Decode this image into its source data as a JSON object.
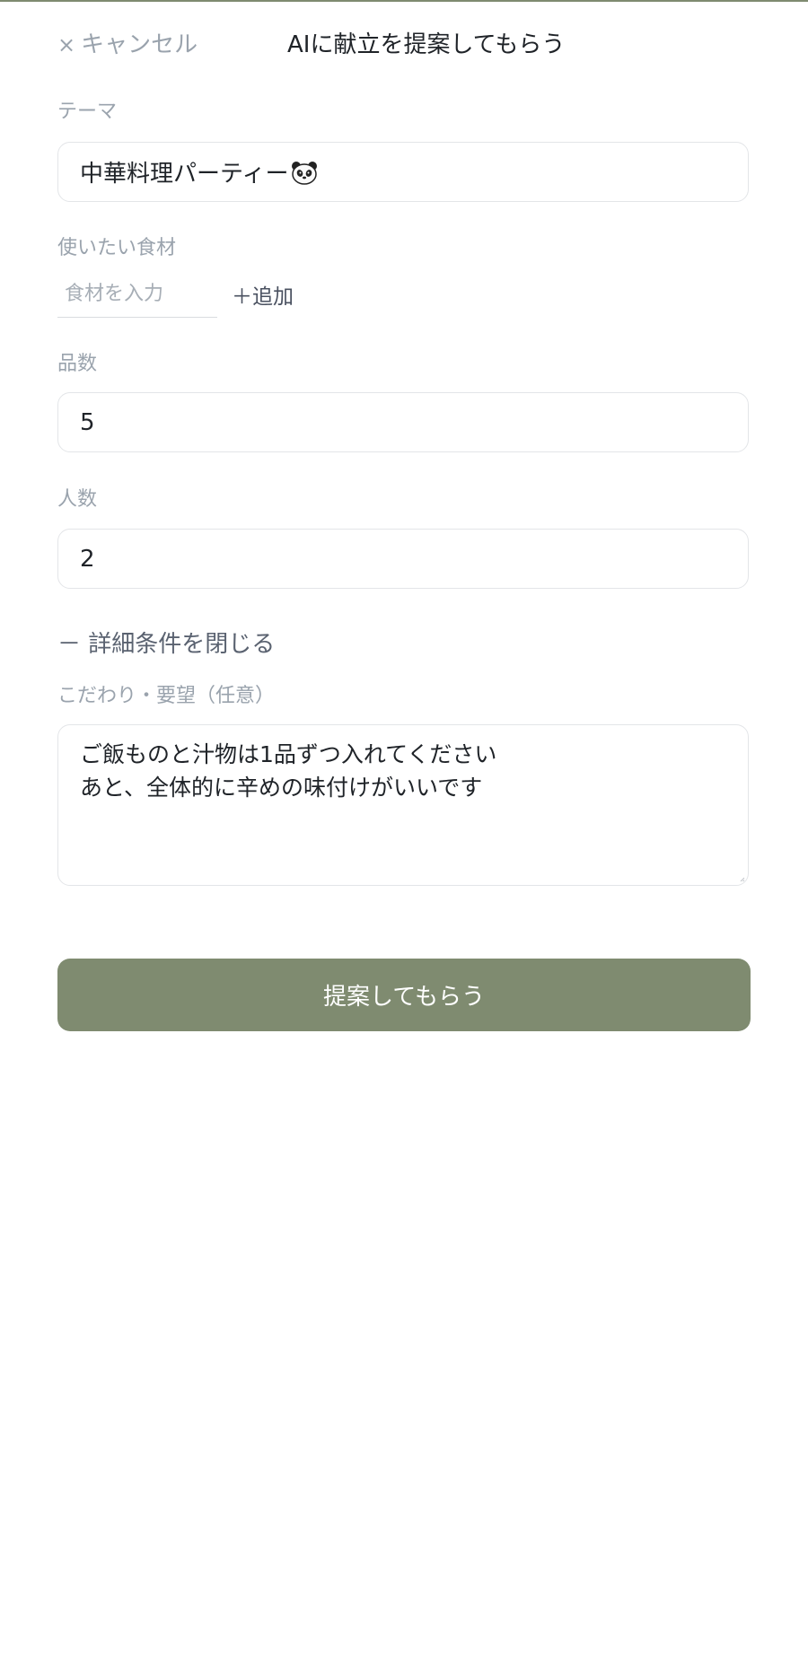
{
  "header": {
    "cancel_icon": "×",
    "cancel_label": "キャンセル",
    "title": "AIに献立を提案してもらう"
  },
  "theme": {
    "label": "テーマ",
    "value": "中華料理パーティー",
    "emoji_icon": "panda-icon"
  },
  "ingredients": {
    "label": "使いたい食材",
    "placeholder": "食材を入力",
    "add_label": "＋追加"
  },
  "dish_count": {
    "label": "品数",
    "value": "5"
  },
  "people_count": {
    "label": "人数",
    "value": "2"
  },
  "details": {
    "toggle_label": "－ 詳細条件を閉じる",
    "requests_label": "こだわり・要望（任意）",
    "requests_lines": [
      "ご飯ものと汁物は1品ずつ入れてください",
      "あと、全体的に辛めの味付けがいいです"
    ]
  },
  "submit": {
    "label": "提案してもらう"
  },
  "colors": {
    "accent": "#7f8b70",
    "label_gray": "#9aa3ad",
    "border": "#e3e5e8"
  }
}
